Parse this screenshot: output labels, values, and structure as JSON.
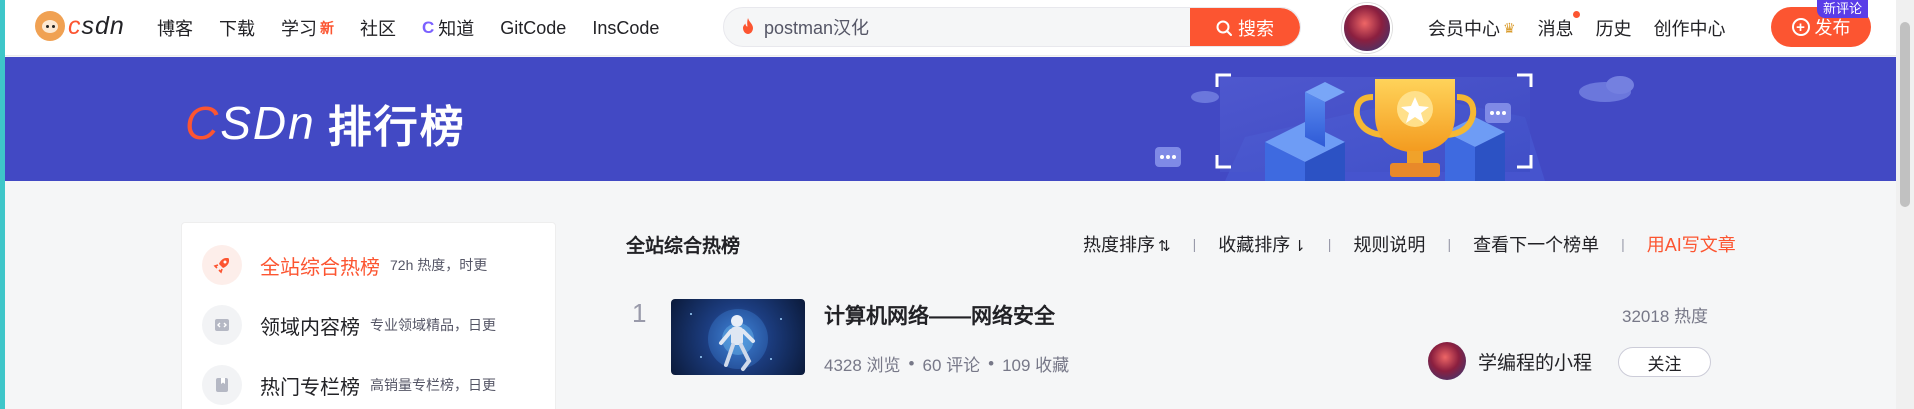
{
  "nav": {
    "logo_text": "CSDN",
    "items": [
      {
        "label": "博客"
      },
      {
        "label": "下载"
      },
      {
        "label": "学习",
        "badge": "新"
      },
      {
        "label": "社区"
      },
      {
        "label": "知道",
        "icon": "zhidao-icon"
      },
      {
        "label": "GitCode"
      },
      {
        "label": "InsCode"
      }
    ],
    "search_value": "postman汉化",
    "search_button": "搜索",
    "right_items": [
      {
        "label": "会员中心",
        "icon": "crown-icon"
      },
      {
        "label": "消息",
        "has_dot": true
      },
      {
        "label": "历史"
      },
      {
        "label": "创作中心"
      }
    ],
    "publish_label": "发布",
    "new_comment_badge": "新评论"
  },
  "banner": {
    "logo_text": "CSDN",
    "title": "排行榜"
  },
  "sidebar": {
    "items": [
      {
        "label": "全站综合热榜",
        "desc": "72h 热度，时更",
        "icon": "rocket-icon",
        "active": true
      },
      {
        "label": "领域内容榜",
        "desc": "专业领域精品，日更",
        "icon": "code-icon",
        "active": false
      },
      {
        "label": "热门专栏榜",
        "desc": "高销量专栏榜，日更",
        "icon": "bookmark-icon",
        "active": false
      }
    ]
  },
  "main": {
    "title": "全站综合热榜",
    "sort_options": [
      {
        "label": "热度排序",
        "icon": "sort-desc-icon"
      },
      {
        "label": "收藏排序",
        "icon": "sort-icon"
      },
      {
        "label": "规则说明"
      },
      {
        "label": "查看下一个榜单"
      },
      {
        "label": "用AI写文章",
        "highlight": true
      }
    ],
    "articles": [
      {
        "rank": "1",
        "title": "计算机网络——网络安全",
        "views": "4328 浏览",
        "comments": "60 评论",
        "favorites": "109 收藏",
        "heat": "32018 热度",
        "author": "学编程的小程",
        "follow_label": "关注"
      }
    ]
  },
  "colors": {
    "accent": "#fc5531",
    "banner_bg": "#4249c4",
    "badge_purple": "#5a3de8"
  }
}
